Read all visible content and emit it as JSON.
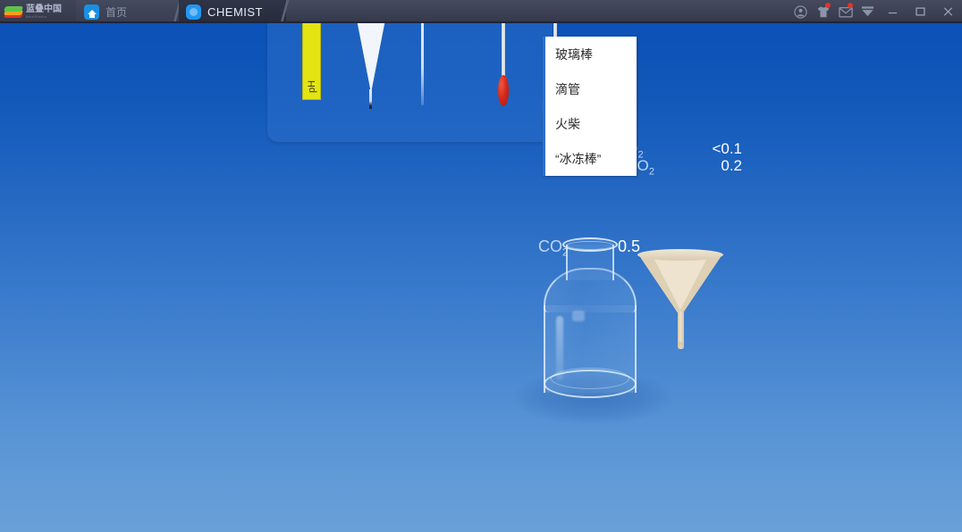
{
  "window": {
    "logo": {
      "cn": "蓝叠中国",
      "en": "BlueStacks"
    },
    "tabs": [
      {
        "label": "首页",
        "icon": "home-icon",
        "active": false
      },
      {
        "label": "CHEMIST",
        "icon": "chemist-app-icon",
        "active": true
      }
    ],
    "tray_icons": [
      {
        "name": "account-icon",
        "badge": false
      },
      {
        "name": "tshirt-icon",
        "badge": true
      },
      {
        "name": "mail-icon",
        "badge": true
      },
      {
        "name": "chevron-down-icon",
        "badge": false
      }
    ],
    "controls": [
      {
        "name": "minimize-button",
        "glyph": "—"
      },
      {
        "name": "maximize-button",
        "glyph": "▢"
      },
      {
        "name": "close-button",
        "glyph": "✕"
      }
    ]
  },
  "shelf": {
    "tools": [
      {
        "name": "ph-paper-strip",
        "label": "pH",
        "color": "#e4e413"
      },
      {
        "name": "dropper-pipette",
        "label": ""
      },
      {
        "name": "glass-stirring-rod",
        "label": ""
      },
      {
        "name": "match-stick",
        "label": ""
      },
      {
        "name": "match-stick-selected",
        "label": ""
      }
    ]
  },
  "dropdown": {
    "items": [
      {
        "label": "玻璃棒"
      },
      {
        "label": "滴管"
      },
      {
        "label": "火柴"
      },
      {
        "label": "“冰冻棒”"
      }
    ]
  },
  "readout": {
    "rows": [
      {
        "label": "O",
        "sub": "2",
        "value": "<0.1"
      },
      {
        "label": "CO",
        "sub": "2",
        "value": "0.2"
      }
    ]
  },
  "bench": {
    "bottle": {
      "name": "reagent-bottle",
      "gas_label": "CO",
      "gas_sub": "2",
      "gas_value": "0.5"
    },
    "funnel": {
      "name": "filter-funnel",
      "color": "#ded0b4"
    }
  },
  "colors": {
    "stage_top": "#0c51b6",
    "stage_bottom": "#6aa0d8",
    "titlebar": "#3a3f52",
    "accent": "#2f6fc4",
    "badge": "#e0342c"
  }
}
